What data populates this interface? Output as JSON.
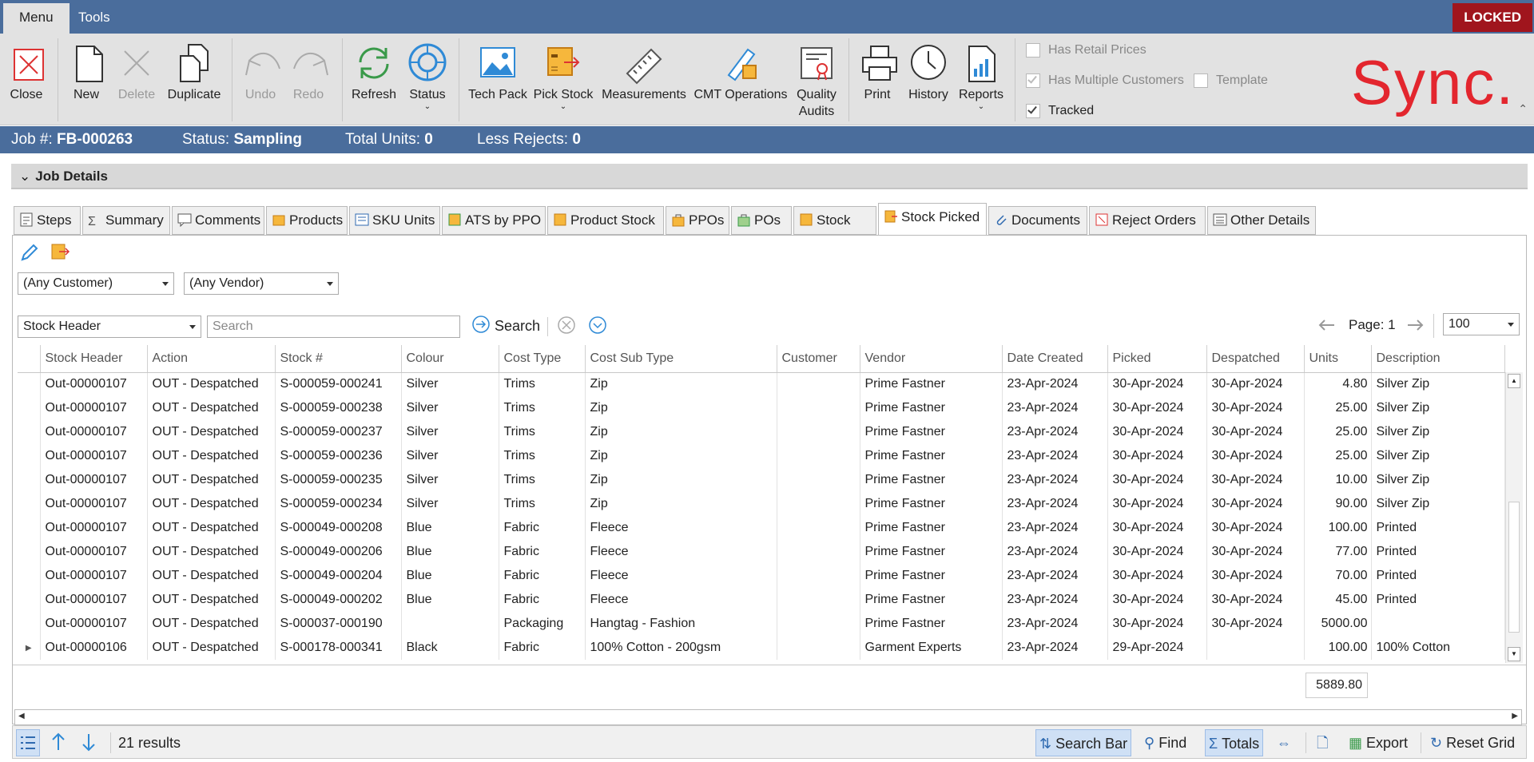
{
  "menu": {
    "tabs": [
      "Menu",
      "Tools"
    ],
    "locked": "LOCKED"
  },
  "ribbon": {
    "buttons": {
      "close": "Close",
      "new": "New",
      "delete": "Delete",
      "duplicate": "Duplicate",
      "undo": "Undo",
      "redo": "Redo",
      "refresh": "Refresh",
      "status": "Status",
      "tech_pack": "Tech Pack",
      "pick_stock": "Pick Stock",
      "measurements": "Measurements",
      "cmt_operations": "CMT Operations",
      "quality_audits_1": "Quality",
      "quality_audits_2": "Audits",
      "print": "Print",
      "history": "History",
      "reports": "Reports"
    },
    "checks": {
      "has_retail_prices": "Has Retail Prices",
      "has_multiple_customers": "Has Multiple Customers",
      "template": "Template",
      "tracked": "Tracked"
    },
    "logo": "Sync."
  },
  "info": {
    "job_label": "Job #:",
    "job_value": "FB-000263",
    "status_label": "Status:",
    "status_value": "Sampling",
    "units_label": "Total Units:",
    "units_value": "0",
    "rejects_label": "Less Rejects:",
    "rejects_value": "0"
  },
  "section": {
    "title": "Job Details"
  },
  "tabs": [
    "Steps",
    "Summary",
    "Comments",
    "Products",
    "SKU Units",
    "ATS by PPO",
    "Product Stock",
    "PPOs",
    "POs",
    "Stock",
    "Stock Picked",
    "Documents",
    "Reject Orders",
    "Other Details"
  ],
  "filters": {
    "customer": "(Any Customer)",
    "vendor": "(Any Vendor)",
    "search_field": "Stock Header",
    "search_placeholder": "Search",
    "search_button": "Search",
    "page_label": "Page: 1",
    "page_size": "100"
  },
  "grid": {
    "columns": [
      "Stock Header",
      "Action",
      "Stock #",
      "Colour",
      "Cost Type",
      "Cost Sub Type",
      "Customer",
      "Vendor",
      "Date Created",
      "Picked",
      "Despatched",
      "Units",
      "Description"
    ],
    "rows": [
      [
        "Out-00000107",
        "OUT - Despatched",
        "S-000059-000241",
        "Silver",
        "Trims",
        "Zip",
        "",
        "Prime Fastner",
        "23-Apr-2024",
        "30-Apr-2024",
        "30-Apr-2024",
        "4.80",
        "Silver Zip"
      ],
      [
        "Out-00000107",
        "OUT - Despatched",
        "S-000059-000238",
        "Silver",
        "Trims",
        "Zip",
        "",
        "Prime Fastner",
        "23-Apr-2024",
        "30-Apr-2024",
        "30-Apr-2024",
        "25.00",
        "Silver Zip"
      ],
      [
        "Out-00000107",
        "OUT - Despatched",
        "S-000059-000237",
        "Silver",
        "Trims",
        "Zip",
        "",
        "Prime Fastner",
        "23-Apr-2024",
        "30-Apr-2024",
        "30-Apr-2024",
        "25.00",
        "Silver Zip"
      ],
      [
        "Out-00000107",
        "OUT - Despatched",
        "S-000059-000236",
        "Silver",
        "Trims",
        "Zip",
        "",
        "Prime Fastner",
        "23-Apr-2024",
        "30-Apr-2024",
        "30-Apr-2024",
        "25.00",
        "Silver Zip"
      ],
      [
        "Out-00000107",
        "OUT - Despatched",
        "S-000059-000235",
        "Silver",
        "Trims",
        "Zip",
        "",
        "Prime Fastner",
        "23-Apr-2024",
        "30-Apr-2024",
        "30-Apr-2024",
        "10.00",
        "Silver Zip"
      ],
      [
        "Out-00000107",
        "OUT - Despatched",
        "S-000059-000234",
        "Silver",
        "Trims",
        "Zip",
        "",
        "Prime Fastner",
        "23-Apr-2024",
        "30-Apr-2024",
        "30-Apr-2024",
        "90.00",
        "Silver Zip"
      ],
      [
        "Out-00000107",
        "OUT - Despatched",
        "S-000049-000208",
        "Blue",
        "Fabric",
        "Fleece",
        "",
        "Prime Fastner",
        "23-Apr-2024",
        "30-Apr-2024",
        "30-Apr-2024",
        "100.00",
        "Printed"
      ],
      [
        "Out-00000107",
        "OUT - Despatched",
        "S-000049-000206",
        "Blue",
        "Fabric",
        "Fleece",
        "",
        "Prime Fastner",
        "23-Apr-2024",
        "30-Apr-2024",
        "30-Apr-2024",
        "77.00",
        "Printed"
      ],
      [
        "Out-00000107",
        "OUT - Despatched",
        "S-000049-000204",
        "Blue",
        "Fabric",
        "Fleece",
        "",
        "Prime Fastner",
        "23-Apr-2024",
        "30-Apr-2024",
        "30-Apr-2024",
        "70.00",
        "Printed"
      ],
      [
        "Out-00000107",
        "OUT - Despatched",
        "S-000049-000202",
        "Blue",
        "Fabric",
        "Fleece",
        "",
        "Prime Fastner",
        "23-Apr-2024",
        "30-Apr-2024",
        "30-Apr-2024",
        "45.00",
        "Printed"
      ],
      [
        "Out-00000107",
        "OUT - Despatched",
        "S-000037-000190",
        "",
        "Packaging",
        "Hangtag - Fashion",
        "",
        "Prime Fastner",
        "23-Apr-2024",
        "30-Apr-2024",
        "30-Apr-2024",
        "5000.00",
        ""
      ],
      [
        "Out-00000106",
        "OUT - Despatched",
        "S-000178-000341",
        "Black",
        "Fabric",
        "100% Cotton - 200gsm",
        "",
        "Garment Experts",
        "23-Apr-2024",
        "29-Apr-2024",
        "",
        "100.00",
        "100% Cotton"
      ]
    ],
    "total": "5889.80"
  },
  "status": {
    "results": "21 results",
    "search_bar": "Search Bar",
    "find": "Find",
    "totals": "Totals",
    "export": "Export",
    "reset_grid": "Reset Grid"
  },
  "colors": {
    "accent": "#4a6d9c",
    "locked": "#a0151d",
    "logo": "#e3262e"
  }
}
